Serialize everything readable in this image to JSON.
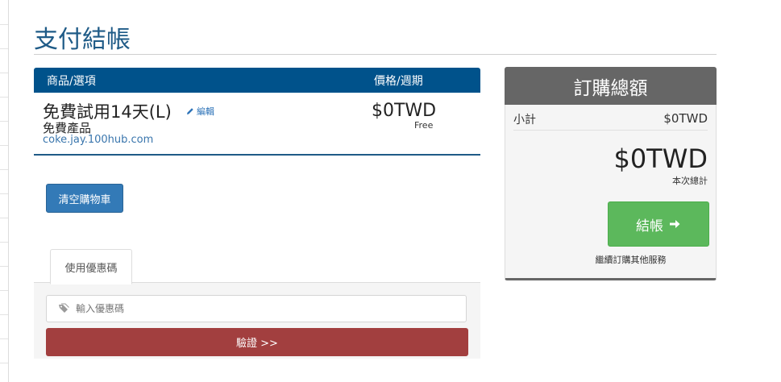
{
  "page": {
    "title": "支付結帳"
  },
  "cart": {
    "header_item": "商品/選項",
    "header_price": "價格/週期",
    "items": [
      {
        "name": "免費試用14天(L)",
        "edit_label": "編輯",
        "group": "免費產品",
        "domain": "coke.jay.100hub.com",
        "price": "$0TWD",
        "cycle": "Free"
      }
    ],
    "empty_button": "清空購物車"
  },
  "promo": {
    "tab_label": "使用優惠碼",
    "input_placeholder": "輸入優惠碼",
    "validate_button": "驗證 >>"
  },
  "summary": {
    "title": "訂購總額",
    "subtotal_label": "小計",
    "subtotal_value": "$0TWD",
    "total_value": "$0TWD",
    "total_label": "本次總計",
    "checkout_button": "結帳",
    "continue_link": "繼續訂購其他服務"
  },
  "colors": {
    "title": "#1f5b87",
    "table_header": "#00528b",
    "empty_button": "#337ab7",
    "validate_button": "#a23f3f",
    "checkout_button": "#5cb85c",
    "summary_header": "#666666"
  },
  "icons": {
    "edit": "pencil-icon",
    "promo": "tag-icon",
    "checkout": "arrow-right-icon"
  }
}
